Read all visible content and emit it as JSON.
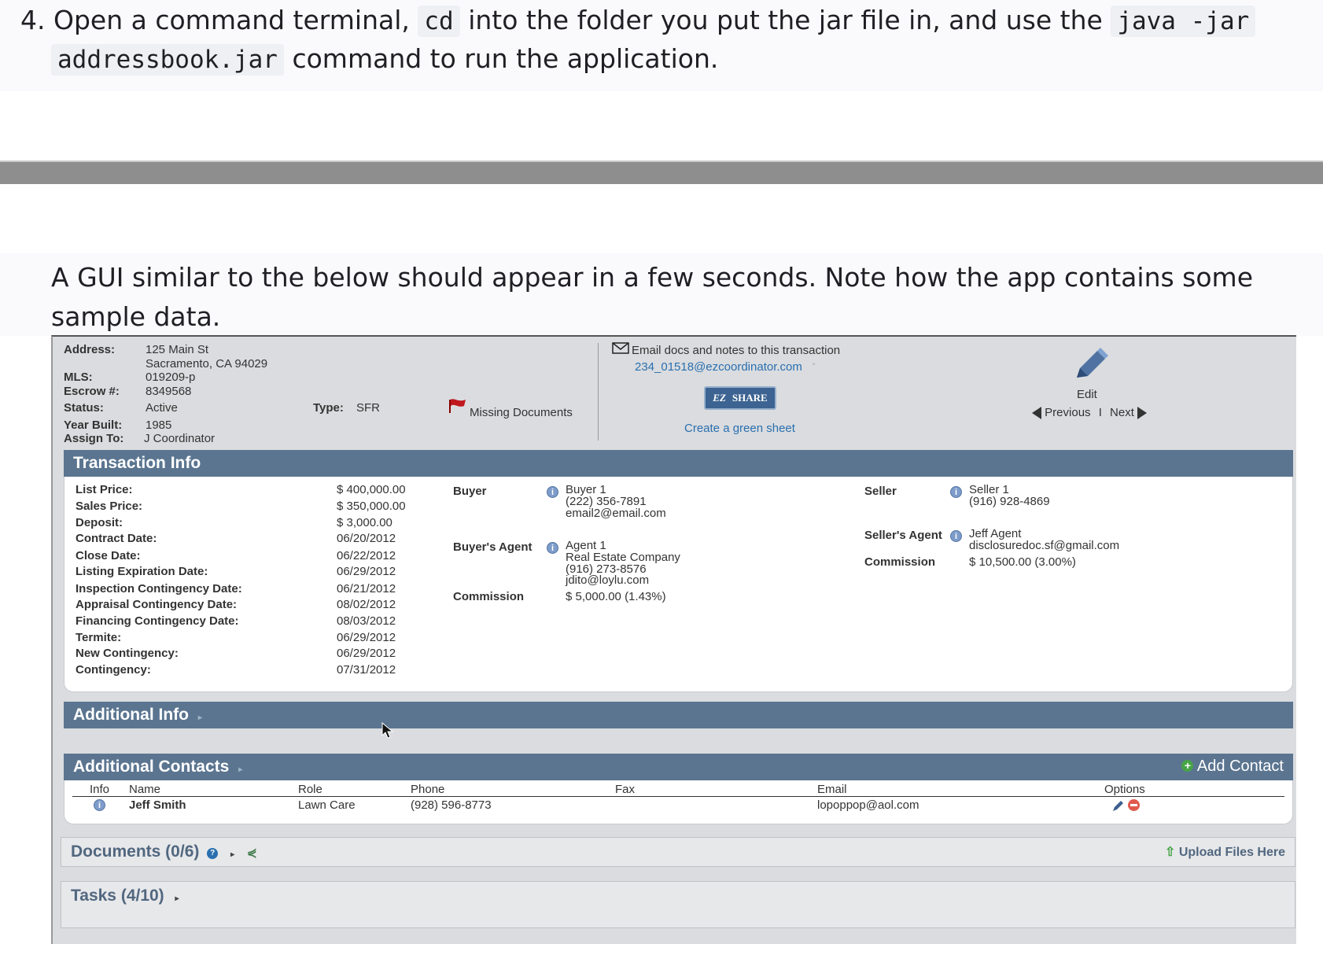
{
  "step": {
    "number": "4.",
    "part1": "Open a command terminal,",
    "code1": "cd",
    "part2": "into the folder you put the jar file in, and use the",
    "code2a": "java -jar",
    "code2b": "addressbook.jar",
    "part3": "command to run the application."
  },
  "intro": "A GUI similar to the below should appear in a few seconds. Note how the app contains some sample data.",
  "app": {
    "header": {
      "address_label": "Address:",
      "address_line1": "125 Main St",
      "address_line2": "Sacramento, CA 94029",
      "mls_label": "MLS:",
      "mls_value": "019209-p",
      "escrow_label": "Escrow #:",
      "escrow_value": "8349568",
      "status_label": "Status:",
      "status_value": "Active",
      "year_label": "Year Built:",
      "year_value": "1985",
      "assign_label": "Assign To:",
      "assign_value": "J Coordinator",
      "type_label": "Type:",
      "type_value": "SFR",
      "missing_docs": "Missing Documents",
      "email_label": "Email docs and notes to this transaction",
      "email_address": "234_01518@ezcoordinator.com",
      "share_label": "SHARE",
      "share_prefix": "EZ",
      "green_sheet": "Create a green sheet",
      "edit_label": "Edit",
      "previous_label": "Previous",
      "separator": "I",
      "next_label": "Next"
    },
    "transaction": {
      "title": "Transaction Info",
      "rows": [
        {
          "label": "List Price:",
          "value": "$ 400,000.00"
        },
        {
          "label": "Sales Price:",
          "value": "$ 350,000.00"
        },
        {
          "label": "Deposit:",
          "value": "$ 3,000.00"
        },
        {
          "label": "Contract Date:",
          "value": "06/20/2012"
        },
        {
          "label": "Close Date:",
          "value": "06/22/2012"
        },
        {
          "label": "Listing Expiration Date:",
          "value": "06/29/2012"
        },
        {
          "label": "Inspection Contingency Date:",
          "value": "06/21/2012"
        },
        {
          "label": "Appraisal Contingency Date:",
          "value": "08/02/2012"
        },
        {
          "label": "Financing Contingency Date:",
          "value": "08/03/2012"
        },
        {
          "label": "Termite:",
          "value": "06/29/2012"
        },
        {
          "label": "New Contingency:",
          "value": "06/29/2012"
        },
        {
          "label": "Contingency:",
          "value": "07/31/2012"
        }
      ],
      "buyer_label": "Buyer",
      "buyer_name": "Buyer 1",
      "buyer_phone": "(222) 356-7891",
      "buyer_email": "email2@email.com",
      "buyers_agent_label": "Buyer's Agent",
      "agent_name": "Agent 1",
      "agent_company": "Real Estate Company",
      "agent_phone": "(916) 273-8576",
      "agent_email": "jdito@loylu.com",
      "buyer_commission_label": "Commission",
      "buyer_commission_value": "$ 5,000.00 (1.43%)",
      "seller_label": "Seller",
      "seller_name": "Seller 1",
      "seller_phone": "(916) 928-4869",
      "sellers_agent_label": "Seller's Agent",
      "seller_agent_name": "Jeff Agent",
      "seller_agent_email": "disclosuredoc.sf@gmail.com",
      "seller_commission_label": "Commission",
      "seller_commission_value": "$ 10,500.00 (3.00%)"
    },
    "additional_info": {
      "title": "Additional Info"
    },
    "contacts": {
      "title": "Additional Contacts",
      "add_label": "Add Contact",
      "columns": [
        "Info",
        "Name",
        "Role",
        "Phone",
        "Fax",
        "Email",
        "Options"
      ],
      "rows": [
        {
          "name": "Jeff Smith",
          "role": "Lawn Care",
          "phone": "(928) 596-8773",
          "fax": "",
          "email": "lopoppop@aol.com"
        }
      ]
    },
    "documents": {
      "title": "Documents (0/6)",
      "upload_label": "Upload Files Here"
    },
    "tasks": {
      "title": "Tasks (4/10)"
    }
  }
}
